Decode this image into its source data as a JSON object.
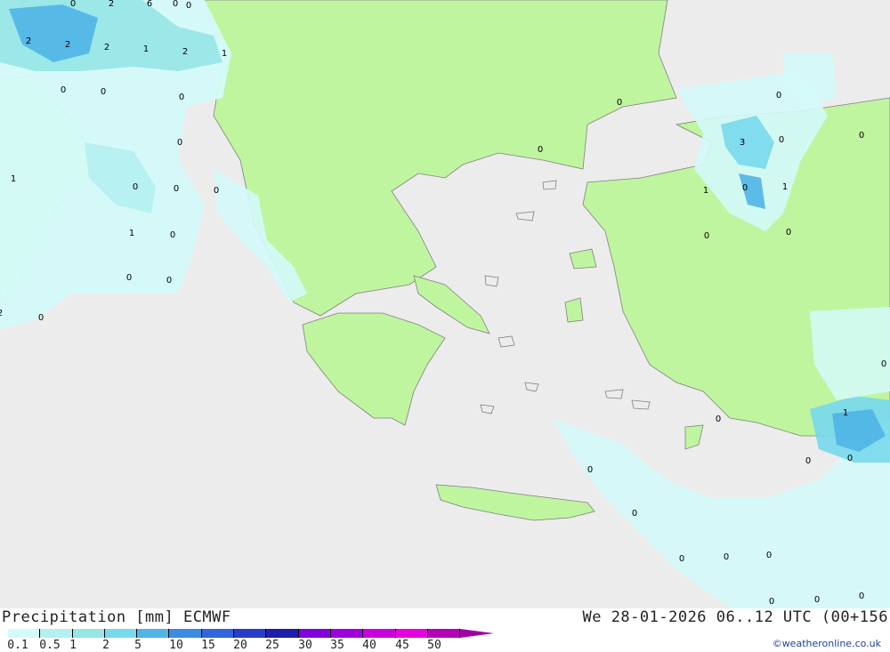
{
  "header": {
    "title": "Precipitation [mm] ECMWF",
    "datetime": "We 28-01-2026 06..12 UTC (00+156"
  },
  "legend": {
    "ticks": [
      "0.1",
      "0.5",
      "1",
      "2",
      "5",
      "10",
      "15",
      "20",
      "25",
      "30",
      "35",
      "40",
      "45",
      "50"
    ],
    "colors": [
      "#d4fafa",
      "#b4f0f0",
      "#96e6e6",
      "#78d8ec",
      "#50b4e6",
      "#3c8ce1",
      "#3264dc",
      "#283cc8",
      "#1e1eaa",
      "#8200dc",
      "#a000dc",
      "#c800dc",
      "#e600dc",
      "#b400b4"
    ],
    "arrow_color": "#a000a0"
  },
  "colors": {
    "sea": "#ececec",
    "land": "#c0f5a0",
    "coast": "#808080"
  },
  "map_labels": [
    "0",
    "2",
    "6",
    "0",
    "2",
    "2",
    "2",
    "1",
    "2",
    "1",
    "0",
    "0",
    "0",
    "0",
    "1",
    "0",
    "0",
    "0",
    "1",
    "0",
    "0",
    "0",
    "0",
    "0",
    "3",
    "0",
    "0",
    "1",
    "1",
    "0",
    "0",
    "0",
    "1",
    "0",
    "0",
    "0",
    "0",
    "0",
    "0",
    "0",
    "0",
    "0",
    "0",
    "0",
    "0",
    "0",
    "0",
    "2",
    "0"
  ],
  "credit": "©weatheronline.co.uk"
}
